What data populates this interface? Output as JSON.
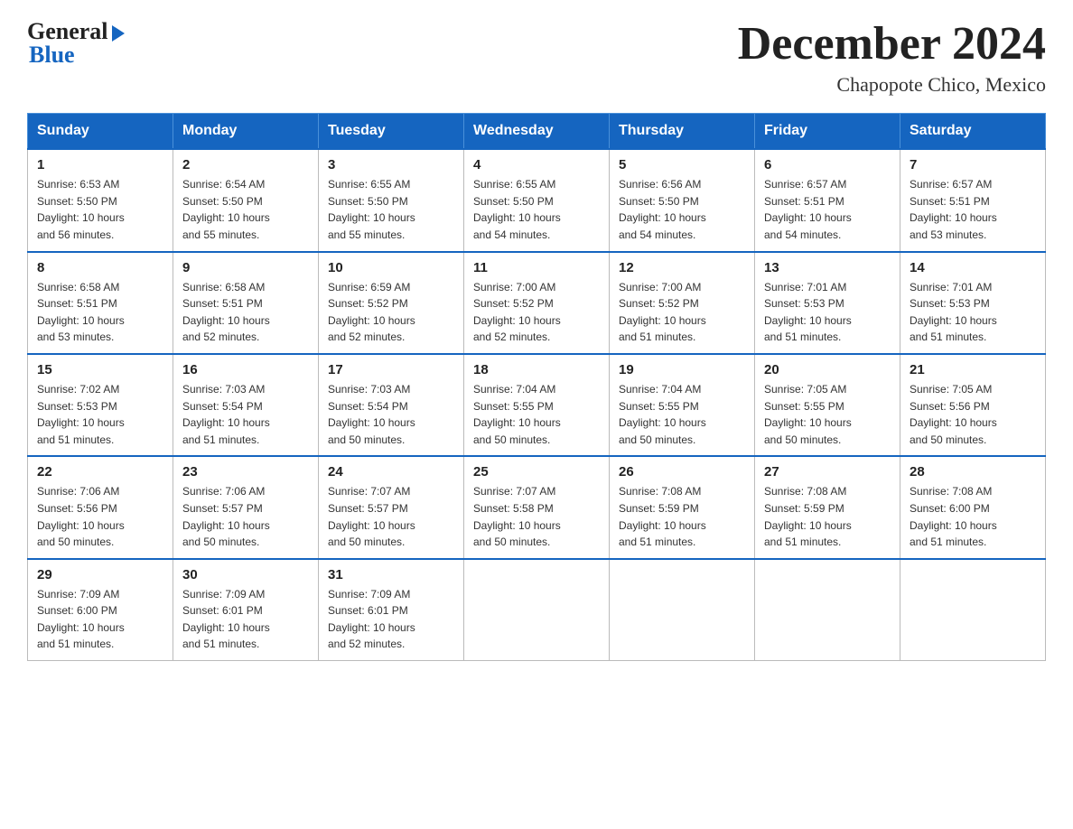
{
  "logo": {
    "general": "General",
    "blue": "Blue"
  },
  "title": "December 2024",
  "location": "Chapopote Chico, Mexico",
  "days_header": [
    "Sunday",
    "Monday",
    "Tuesday",
    "Wednesday",
    "Thursday",
    "Friday",
    "Saturday"
  ],
  "weeks": [
    [
      {
        "day": "1",
        "sunrise": "6:53 AM",
        "sunset": "5:50 PM",
        "daylight": "10 hours and 56 minutes."
      },
      {
        "day": "2",
        "sunrise": "6:54 AM",
        "sunset": "5:50 PM",
        "daylight": "10 hours and 55 minutes."
      },
      {
        "day": "3",
        "sunrise": "6:55 AM",
        "sunset": "5:50 PM",
        "daylight": "10 hours and 55 minutes."
      },
      {
        "day": "4",
        "sunrise": "6:55 AM",
        "sunset": "5:50 PM",
        "daylight": "10 hours and 54 minutes."
      },
      {
        "day": "5",
        "sunrise": "6:56 AM",
        "sunset": "5:50 PM",
        "daylight": "10 hours and 54 minutes."
      },
      {
        "day": "6",
        "sunrise": "6:57 AM",
        "sunset": "5:51 PM",
        "daylight": "10 hours and 54 minutes."
      },
      {
        "day": "7",
        "sunrise": "6:57 AM",
        "sunset": "5:51 PM",
        "daylight": "10 hours and 53 minutes."
      }
    ],
    [
      {
        "day": "8",
        "sunrise": "6:58 AM",
        "sunset": "5:51 PM",
        "daylight": "10 hours and 53 minutes."
      },
      {
        "day": "9",
        "sunrise": "6:58 AM",
        "sunset": "5:51 PM",
        "daylight": "10 hours and 52 minutes."
      },
      {
        "day": "10",
        "sunrise": "6:59 AM",
        "sunset": "5:52 PM",
        "daylight": "10 hours and 52 minutes."
      },
      {
        "day": "11",
        "sunrise": "7:00 AM",
        "sunset": "5:52 PM",
        "daylight": "10 hours and 52 minutes."
      },
      {
        "day": "12",
        "sunrise": "7:00 AM",
        "sunset": "5:52 PM",
        "daylight": "10 hours and 51 minutes."
      },
      {
        "day": "13",
        "sunrise": "7:01 AM",
        "sunset": "5:53 PM",
        "daylight": "10 hours and 51 minutes."
      },
      {
        "day": "14",
        "sunrise": "7:01 AM",
        "sunset": "5:53 PM",
        "daylight": "10 hours and 51 minutes."
      }
    ],
    [
      {
        "day": "15",
        "sunrise": "7:02 AM",
        "sunset": "5:53 PM",
        "daylight": "10 hours and 51 minutes."
      },
      {
        "day": "16",
        "sunrise": "7:03 AM",
        "sunset": "5:54 PM",
        "daylight": "10 hours and 51 minutes."
      },
      {
        "day": "17",
        "sunrise": "7:03 AM",
        "sunset": "5:54 PM",
        "daylight": "10 hours and 50 minutes."
      },
      {
        "day": "18",
        "sunrise": "7:04 AM",
        "sunset": "5:55 PM",
        "daylight": "10 hours and 50 minutes."
      },
      {
        "day": "19",
        "sunrise": "7:04 AM",
        "sunset": "5:55 PM",
        "daylight": "10 hours and 50 minutes."
      },
      {
        "day": "20",
        "sunrise": "7:05 AM",
        "sunset": "5:55 PM",
        "daylight": "10 hours and 50 minutes."
      },
      {
        "day": "21",
        "sunrise": "7:05 AM",
        "sunset": "5:56 PM",
        "daylight": "10 hours and 50 minutes."
      }
    ],
    [
      {
        "day": "22",
        "sunrise": "7:06 AM",
        "sunset": "5:56 PM",
        "daylight": "10 hours and 50 minutes."
      },
      {
        "day": "23",
        "sunrise": "7:06 AM",
        "sunset": "5:57 PM",
        "daylight": "10 hours and 50 minutes."
      },
      {
        "day": "24",
        "sunrise": "7:07 AM",
        "sunset": "5:57 PM",
        "daylight": "10 hours and 50 minutes."
      },
      {
        "day": "25",
        "sunrise": "7:07 AM",
        "sunset": "5:58 PM",
        "daylight": "10 hours and 50 minutes."
      },
      {
        "day": "26",
        "sunrise": "7:08 AM",
        "sunset": "5:59 PM",
        "daylight": "10 hours and 51 minutes."
      },
      {
        "day": "27",
        "sunrise": "7:08 AM",
        "sunset": "5:59 PM",
        "daylight": "10 hours and 51 minutes."
      },
      {
        "day": "28",
        "sunrise": "7:08 AM",
        "sunset": "6:00 PM",
        "daylight": "10 hours and 51 minutes."
      }
    ],
    [
      {
        "day": "29",
        "sunrise": "7:09 AM",
        "sunset": "6:00 PM",
        "daylight": "10 hours and 51 minutes."
      },
      {
        "day": "30",
        "sunrise": "7:09 AM",
        "sunset": "6:01 PM",
        "daylight": "10 hours and 51 minutes."
      },
      {
        "day": "31",
        "sunrise": "7:09 AM",
        "sunset": "6:01 PM",
        "daylight": "10 hours and 52 minutes."
      },
      null,
      null,
      null,
      null
    ]
  ],
  "labels": {
    "sunrise": "Sunrise:",
    "sunset": "Sunset:",
    "daylight": "Daylight:"
  }
}
